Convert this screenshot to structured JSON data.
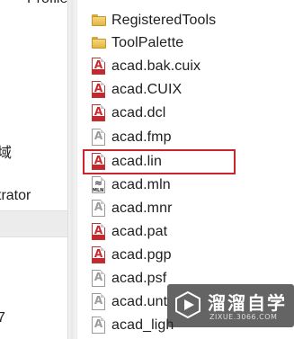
{
  "nav": {
    "items": [
      "Profiles",
      "域",
      "trator",
      "7"
    ]
  },
  "files": [
    {
      "name": "RegisteredTools",
      "type": "folder"
    },
    {
      "name": "ToolPalette",
      "type": "folder"
    },
    {
      "name": "acad.bak.cuix",
      "type": "acad"
    },
    {
      "name": "acad.CUIX",
      "type": "acad"
    },
    {
      "name": "acad.dcl",
      "type": "acad"
    },
    {
      "name": "acad.fmp",
      "type": "plain"
    },
    {
      "name": "acad.lin",
      "type": "acad",
      "selected": true
    },
    {
      "name": "acad.mln",
      "type": "mln"
    },
    {
      "name": "acad.mnr",
      "type": "plain"
    },
    {
      "name": "acad.pat",
      "type": "acad"
    },
    {
      "name": "acad.pgp",
      "type": "acad"
    },
    {
      "name": "acad.psf",
      "type": "plain"
    },
    {
      "name": "acad.unt",
      "type": "plain"
    },
    {
      "name": "acad_ligh",
      "type": "plain"
    }
  ],
  "highlight_color": "#c8262c",
  "watermark": {
    "title": "溜溜自学",
    "subtitle": "ZIXUE.3066.COM"
  }
}
